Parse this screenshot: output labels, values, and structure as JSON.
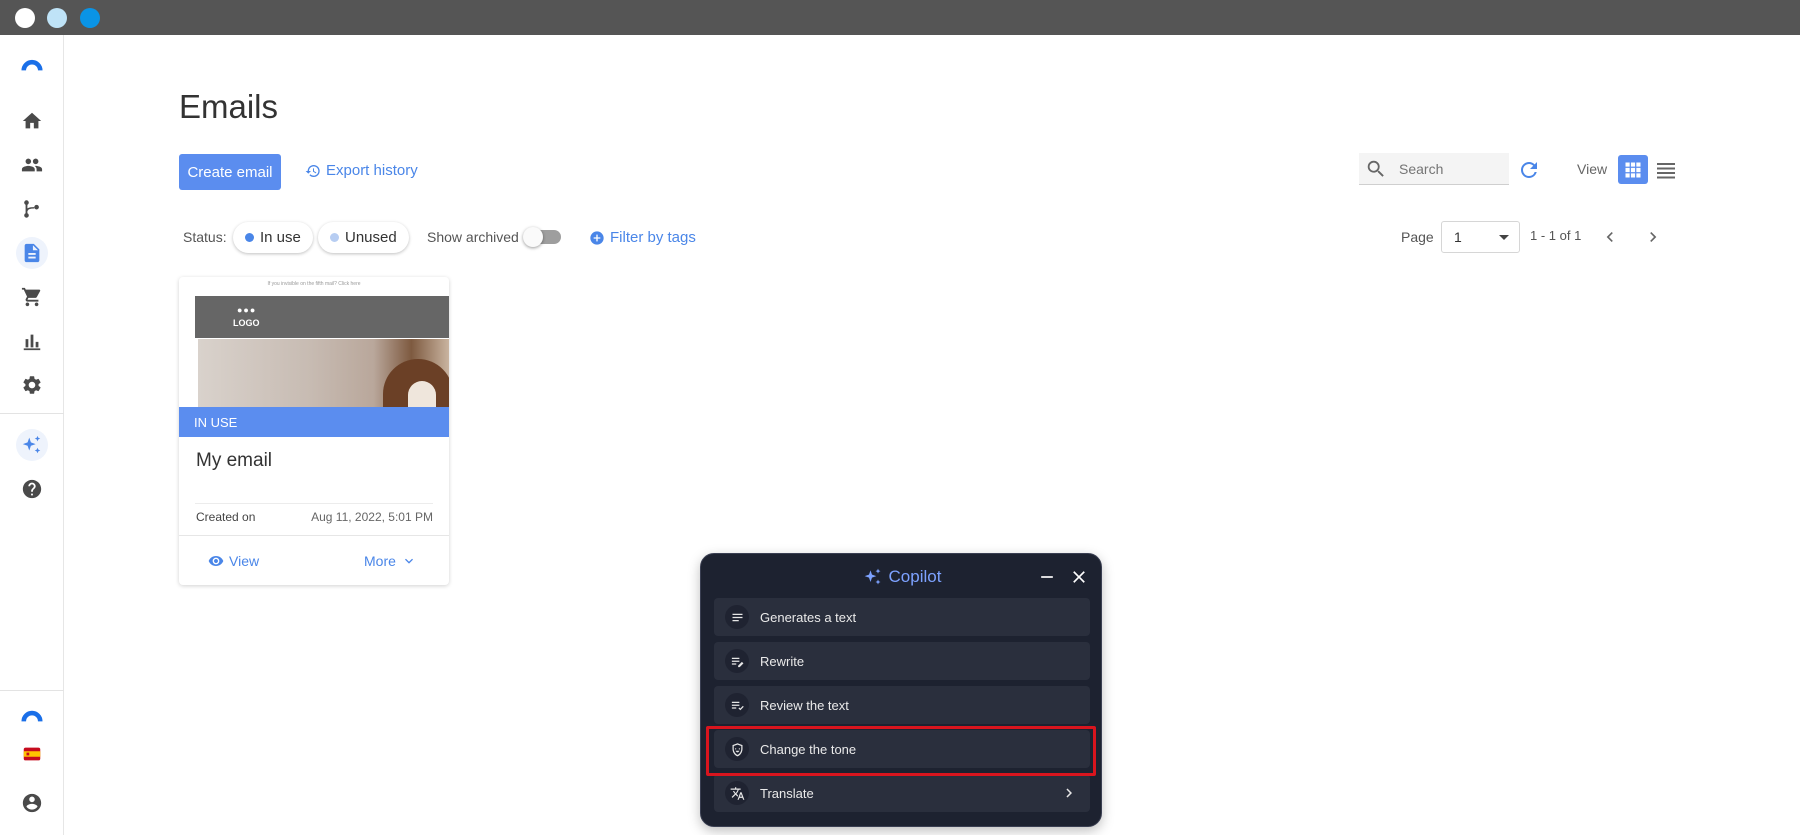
{
  "page": {
    "title": "Emails"
  },
  "toolbar": {
    "create_label": "Create email",
    "export_label": "Export history",
    "search_placeholder": "Search",
    "view_label": "View"
  },
  "filters": {
    "status_label": "Status:",
    "in_use_label": "In use",
    "unused_label": "Unused",
    "show_archived_label": "Show archived",
    "show_archived_on": false,
    "filter_by_tags_label": "Filter by tags"
  },
  "pagination": {
    "page_label": "Page",
    "current_page": "1",
    "range_label": "1 - 1 of 1"
  },
  "card": {
    "thumb_text": "If you invisible on the fifth mail? Click here",
    "thumb_logo": "LOGO",
    "status_band": "IN USE",
    "title": "My email",
    "created_label": "Created on",
    "created_value": "Aug 11, 2022, 5:01 PM",
    "view_label": "View",
    "more_label": "More"
  },
  "copilot": {
    "title": "Copilot",
    "items": [
      {
        "label": "Generates a text",
        "icon": "text-lines-icon"
      },
      {
        "label": "Rewrite",
        "icon": "rewrite-icon"
      },
      {
        "label": "Review the text",
        "icon": "review-check-icon"
      },
      {
        "label": "Change the tone",
        "icon": "tone-icon",
        "highlighted": true
      },
      {
        "label": "Translate",
        "icon": "translate-icon",
        "has_submenu": true
      }
    ]
  },
  "colors": {
    "accent": "#5b8def",
    "copilot_bg": "#1d2230",
    "highlight": "#d9151e",
    "in_use_dot": "#4a86e8",
    "unused_dot": "#b7cdf2"
  }
}
